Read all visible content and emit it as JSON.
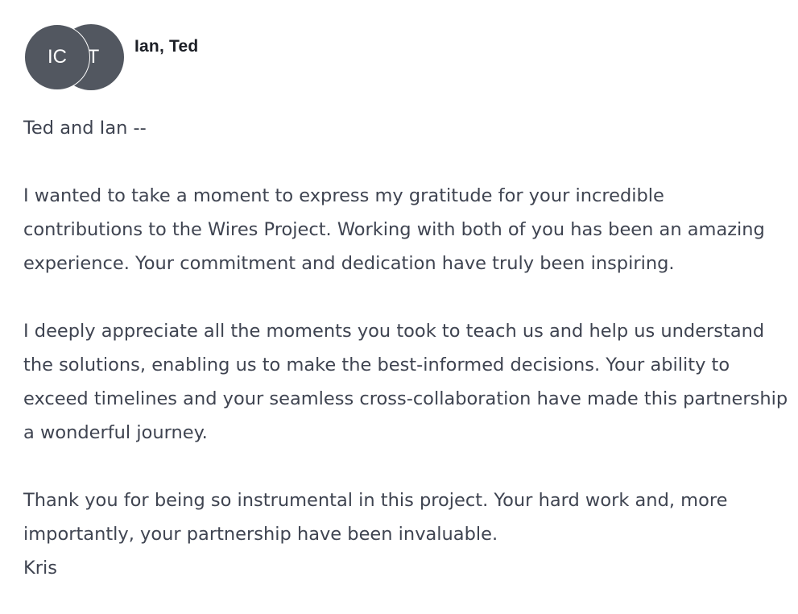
{
  "header": {
    "avatars": [
      {
        "initials": "IC"
      },
      {
        "initials": "T"
      }
    ],
    "recipients": "Ian, Ted"
  },
  "message": {
    "greeting": "Ted and Ian --",
    "paragraphs": [
      "I wanted to take a moment to express my gratitude for your incredible contributions to the Wires Project. Working with both of you has been an amazing experience. Your commitment and dedication have truly been inspiring.",
      "I deeply appreciate all the moments you took to teach us and help us understand the solutions, enabling us to make the best-informed decisions. Your ability to exceed timelines and your seamless cross-collaboration have made this partnership a wonderful journey.",
      "Thank you for being so instrumental in this project. Your hard work and, more importantly, your partnership have been invaluable."
    ],
    "signature": "Kris"
  }
}
